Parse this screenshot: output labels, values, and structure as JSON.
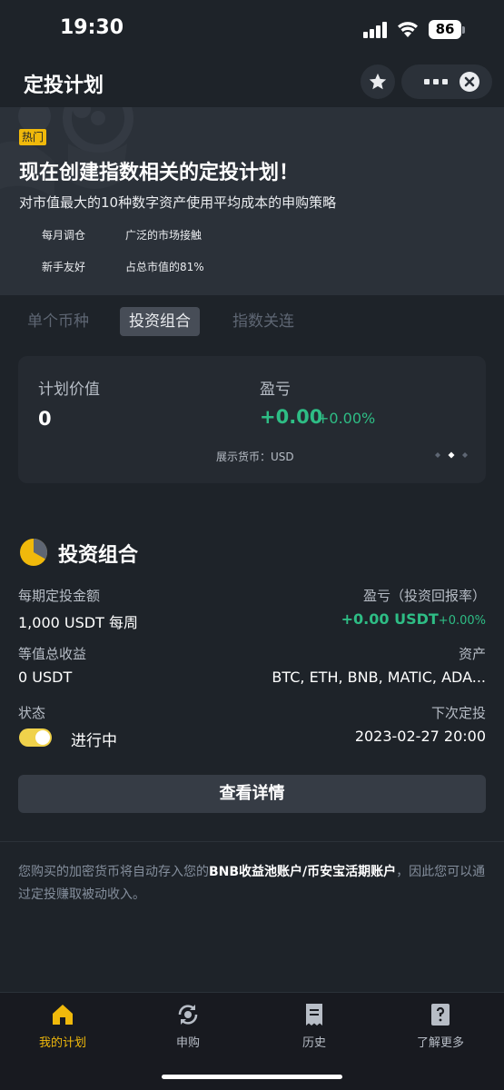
{
  "status_bar": {
    "time": "19:30",
    "battery": "86"
  },
  "header": {
    "title": "定投计划"
  },
  "hero": {
    "badge": "热门",
    "title": "现在创建指数相关的定投计划！",
    "subtitle": "对市值最大的10种数字资产使用平均成本的申购策略",
    "features": [
      "每月调仓",
      "广泛的市场接触",
      "新手友好",
      "占总市值的81%"
    ]
  },
  "tabs": [
    "单个币种",
    "投资组合",
    "指数关连"
  ],
  "plan_card": {
    "value_label": "计划价值",
    "value": "0",
    "pnl_label": "盈亏",
    "pnl": "+0.00",
    "pnl_pct": "+0.00%",
    "currency_note": "展示货币：USD"
  },
  "portfolio": {
    "title": "投资组合",
    "amount_label": "每期定投金额",
    "amount": "1,000 USDT 每周",
    "roi_label": "盈亏（投资回报率）",
    "roi_value": "+0.00 USDT",
    "roi_pct": "+0.00%",
    "earnings_label": "等值总收益",
    "earnings": "0 USDT",
    "assets_label": "资产",
    "assets": "BTC, ETH, BNB, MATIC, ADA...",
    "status_label": "状态",
    "status": "进行中",
    "next_label": "下次定投",
    "next": "2023-02-27 20:00",
    "details_button": "查看详情"
  },
  "note": {
    "prefix": "您购买的加密货币将自动存入您的",
    "highlight": "BNB收益池账户/币安宝活期账户",
    "suffix": "，因此您可以通过定投赚取被动收入。"
  },
  "tabbar": {
    "items": [
      {
        "label": "我的计划",
        "icon": "home-icon",
        "active": true
      },
      {
        "label": "申购",
        "icon": "recurring-icon",
        "active": false
      },
      {
        "label": "历史",
        "icon": "receipt-icon",
        "active": false
      },
      {
        "label": "了解更多",
        "icon": "help-doc-icon",
        "active": false
      }
    ]
  },
  "colors": {
    "accent": "#f0b90b",
    "positive": "#2ebd85",
    "background": "#1e2329"
  }
}
